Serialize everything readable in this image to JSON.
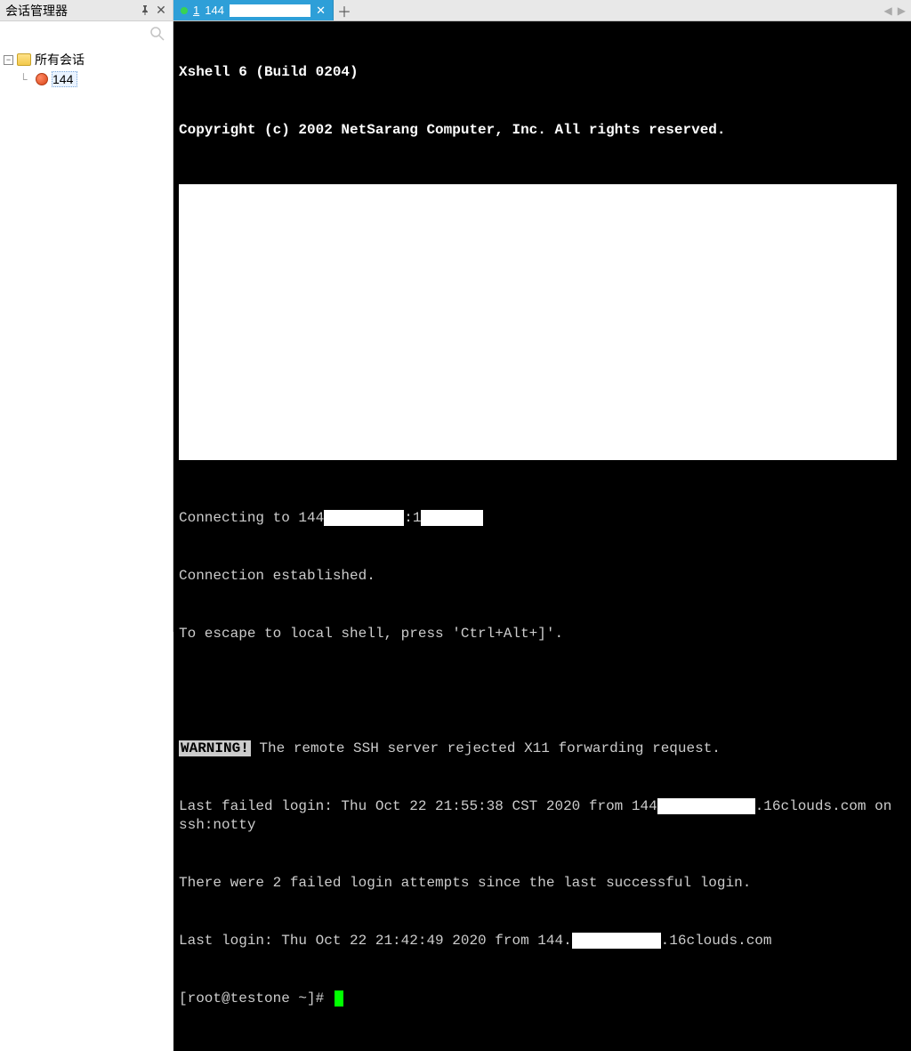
{
  "sidebar": {
    "title": "会话管理器",
    "root_label": "所有会话",
    "session_label": "144"
  },
  "tab": {
    "num": "1",
    "label_prefix": "144"
  },
  "terminal": {
    "header_line1": "Xshell 6 (Build 0204)",
    "header_line2": "Copyright (c) 2002 NetSarang Computer, Inc. All rights reserved.",
    "connecting_prefix": "Connecting to 144",
    "connecting_mid": ":1",
    "conn_established": "Connection established.",
    "escape_hint": "To escape to local shell, press 'Ctrl+Alt+]'.",
    "warning_label": "WARNING!",
    "warning_text": " The remote SSH server rejected X11 forwarding request.",
    "fail_login_prefix": "Last failed login: Thu Oct 22 21:55:38 CST 2020 from 144",
    "fail_login_suffix": ".16clouds.com on ssh:notty",
    "failed_attempts": "There were 2 failed login attempts since the last successful login.",
    "last_login_prefix": "Last login: Thu Oct 22 21:42:49 2020 from 144.",
    "last_login_suffix": ".16clouds.com",
    "prompt": "[root@testone ~]# "
  }
}
